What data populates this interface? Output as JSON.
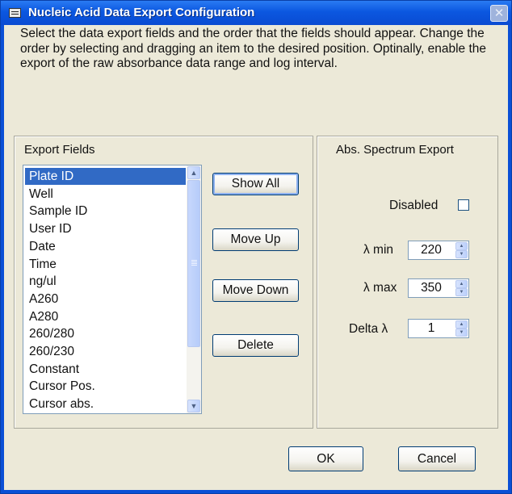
{
  "window": {
    "title": "Nucleic Acid Data Export Configuration",
    "close_glyph": "✕"
  },
  "intro_text": "Select the data export fields and the order that the fields should appear. Change the order by selecting and dragging an item to the desired position.  Optinally, enable the export of the raw absorbance data range and log interval.",
  "export_fields": {
    "label": "Export Fields",
    "items": [
      "Plate ID",
      "Well",
      "Sample ID",
      "User ID",
      "Date",
      "Time",
      "ng/ul",
      "A260",
      "A280",
      "260/280",
      "260/230",
      "Constant",
      "Cursor Pos.",
      "Cursor abs."
    ],
    "selected": "Plate ID"
  },
  "buttons": {
    "show_all": "Show All",
    "move_up": "Move Up",
    "move_down": "Move Down",
    "delete": "Delete",
    "ok": "OK",
    "cancel": "Cancel"
  },
  "spectrum": {
    "label": "Abs. Spectrum Export",
    "disabled_label": "Disabled",
    "disabled_checked": false,
    "lambda_min_label": "λ min",
    "lambda_min": "220",
    "lambda_max_label": "λ max",
    "lambda_max": "350",
    "delta_label": "Delta λ",
    "delta": "1"
  },
  "colors": {
    "title_bar": "#0b57e0",
    "dialog_bg": "#ece9d8",
    "selection": "#316ac5"
  }
}
